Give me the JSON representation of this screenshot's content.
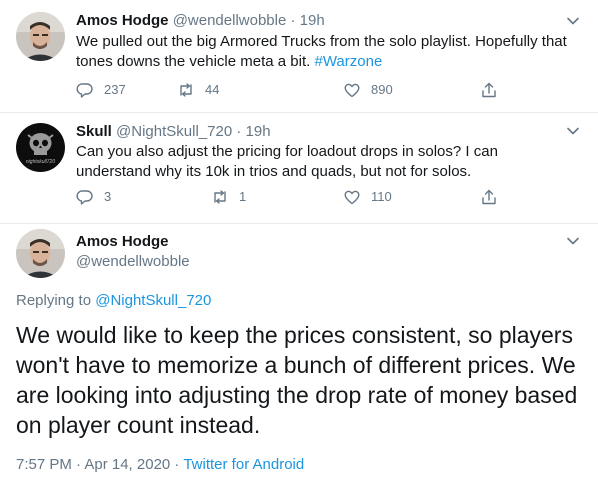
{
  "tweets": [
    {
      "name": "Amos Hodge",
      "handle": "@wendellwobble",
      "separator": "·",
      "time": "19h",
      "text_main": "We pulled out the big Armored Trucks from the solo playlist. Hopefully that tones downs the vehicle meta a bit.",
      "hashtag": "#Warzone",
      "replies": "237",
      "retweets": "44",
      "likes": "890"
    },
    {
      "name": "Skull",
      "handle": "@NightSkull_720",
      "separator": "·",
      "time": "19h",
      "text_main": "Can you also adjust the pricing for loadout drops in solos? I can understand why its 10k in trios and quads, but not for solos.",
      "replies": "3",
      "retweets": "1",
      "likes": "110",
      "avatar_text": "nightskull720"
    }
  ],
  "main_tweet": {
    "name": "Amos Hodge",
    "handle": "@wendellwobble",
    "replying_prefix": "Replying to",
    "replying_to": "@NightSkull_720",
    "text": "We would like to keep the prices consistent, so players won't have to memorize a bunch of different prices. We are looking into adjusting the drop rate of money based on player count instead.",
    "timestamp": "7:57 PM · Apr 14, 2020 ·",
    "source": "Twitter for Android"
  },
  "icons": [
    "reply-icon",
    "retweet-icon",
    "like-icon",
    "share-icon",
    "chevron-down-icon"
  ],
  "colors": {
    "link": "#1b95e0",
    "muted": "#657786",
    "text": "#14171a",
    "divider": "#e6ecf0"
  }
}
